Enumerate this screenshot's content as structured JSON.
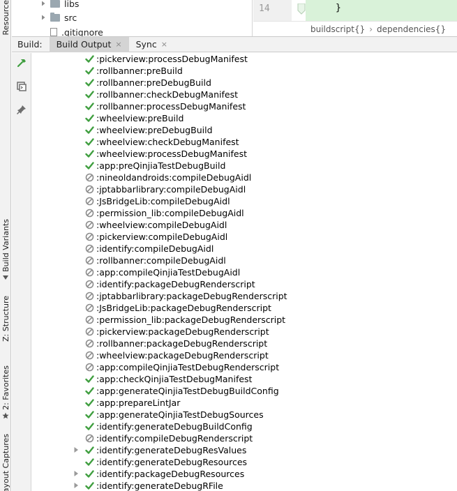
{
  "left_strip": {
    "tabs": [
      "Resource",
      "Build Variants",
      "Z: Structure",
      "2: Favorites",
      "Layout Captures"
    ]
  },
  "project_tree": {
    "items": [
      {
        "label": "libs",
        "kind": "folder"
      },
      {
        "label": "src",
        "kind": "folder"
      },
      {
        "label": ".gitignore",
        "kind": "file"
      }
    ]
  },
  "editor": {
    "line_number": "14",
    "code": "}",
    "breadcrumbs": [
      "buildscript{}",
      "dependencies{}"
    ],
    "highlight_color": "#d9f2d9"
  },
  "build_window": {
    "title": "Build:",
    "tabs": [
      {
        "label": "Build Output",
        "active": true
      },
      {
        "label": "Sync",
        "active": false
      }
    ],
    "close_glyph": "×"
  },
  "toolbar": {
    "buttons": [
      "hammer-icon",
      "console-icon",
      "pin-icon"
    ]
  },
  "colors": {
    "success": "#3f9e3f",
    "skipped": "#8c8c8c",
    "active_tab": "#d4d4d4"
  },
  "tasks": [
    {
      "name": ":pickerview:processDebugManifest",
      "status": "success",
      "expandable": false
    },
    {
      "name": ":rollbanner:preBuild",
      "status": "success",
      "expandable": false
    },
    {
      "name": ":rollbanner:preDebugBuild",
      "status": "success",
      "expandable": false
    },
    {
      "name": ":rollbanner:checkDebugManifest",
      "status": "success",
      "expandable": false
    },
    {
      "name": ":rollbanner:processDebugManifest",
      "status": "success",
      "expandable": false
    },
    {
      "name": ":wheelview:preBuild",
      "status": "success",
      "expandable": false
    },
    {
      "name": ":wheelview:preDebugBuild",
      "status": "success",
      "expandable": false
    },
    {
      "name": ":wheelview:checkDebugManifest",
      "status": "success",
      "expandable": false
    },
    {
      "name": ":wheelview:processDebugManifest",
      "status": "success",
      "expandable": false
    },
    {
      "name": ":app:preQinjiaTestDebugBuild",
      "status": "success",
      "expandable": false
    },
    {
      "name": ":nineoldandroids:compileDebugAidl",
      "status": "skipped",
      "expandable": false
    },
    {
      "name": ":jptabbarlibrary:compileDebugAidl",
      "status": "skipped",
      "expandable": false
    },
    {
      "name": ":JsBridgeLib:compileDebugAidl",
      "status": "skipped",
      "expandable": false
    },
    {
      "name": ":permission_lib:compileDebugAidl",
      "status": "skipped",
      "expandable": false
    },
    {
      "name": ":wheelview:compileDebugAidl",
      "status": "skipped",
      "expandable": false
    },
    {
      "name": ":pickerview:compileDebugAidl",
      "status": "skipped",
      "expandable": false
    },
    {
      "name": ":identify:compileDebugAidl",
      "status": "skipped",
      "expandable": false
    },
    {
      "name": ":rollbanner:compileDebugAidl",
      "status": "skipped",
      "expandable": false
    },
    {
      "name": ":app:compileQinjiaTestDebugAidl",
      "status": "skipped",
      "expandable": false
    },
    {
      "name": ":identify:packageDebugRenderscript",
      "status": "skipped",
      "expandable": false
    },
    {
      "name": ":jptabbarlibrary:packageDebugRenderscript",
      "status": "skipped",
      "expandable": false
    },
    {
      "name": ":JsBridgeLib:packageDebugRenderscript",
      "status": "skipped",
      "expandable": false
    },
    {
      "name": ":permission_lib:packageDebugRenderscript",
      "status": "skipped",
      "expandable": false
    },
    {
      "name": ":pickerview:packageDebugRenderscript",
      "status": "skipped",
      "expandable": false
    },
    {
      "name": ":rollbanner:packageDebugRenderscript",
      "status": "skipped",
      "expandable": false
    },
    {
      "name": ":wheelview:packageDebugRenderscript",
      "status": "skipped",
      "expandable": false
    },
    {
      "name": ":app:compileQinjiaTestDebugRenderscript",
      "status": "skipped",
      "expandable": false
    },
    {
      "name": ":app:checkQinjiaTestDebugManifest",
      "status": "success",
      "expandable": false
    },
    {
      "name": ":app:generateQinjiaTestDebugBuildConfig",
      "status": "success",
      "expandable": false
    },
    {
      "name": ":app:prepareLintJar",
      "status": "success",
      "expandable": false
    },
    {
      "name": ":app:generateQinjiaTestDebugSources",
      "status": "success",
      "expandable": false
    },
    {
      "name": ":identify:generateDebugBuildConfig",
      "status": "success",
      "expandable": false
    },
    {
      "name": ":identify:compileDebugRenderscript",
      "status": "skipped",
      "expandable": false
    },
    {
      "name": ":identify:generateDebugResValues",
      "status": "success",
      "expandable": true
    },
    {
      "name": ":identify:generateDebugResources",
      "status": "success",
      "expandable": false
    },
    {
      "name": ":identify:packageDebugResources",
      "status": "success",
      "expandable": true
    },
    {
      "name": ":identify:generateDebugRFile",
      "status": "success",
      "expandable": true
    }
  ]
}
